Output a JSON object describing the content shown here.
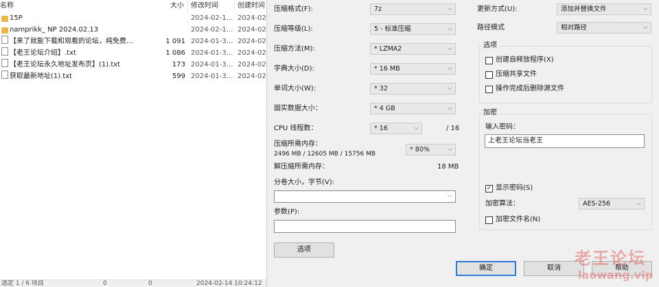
{
  "file_list": {
    "headers": {
      "name": "名称",
      "size": "大小",
      "modified": "修改时间",
      "created": "创建时间"
    },
    "rows": [
      {
        "icon": "folder-icon",
        "name": "15P",
        "size": "",
        "modified": "2024-02-1...",
        "created": "2024-02"
      },
      {
        "icon": "folder-icon",
        "name": "namprikk_ NP 2024.02.13",
        "size": "",
        "modified": "2024-02-1...",
        "created": "2024-02"
      },
      {
        "icon": "text-file-icon",
        "name": "【来了就能下载和观看的论坛，纯免费...",
        "size": "1 091",
        "modified": "2024-01-3...",
        "created": "2024-02"
      },
      {
        "icon": "text-file-icon",
        "name": "【老王论坛介绍】.txt",
        "size": "1 086",
        "modified": "2024-01-3...",
        "created": "2024-02"
      },
      {
        "icon": "text-file-icon",
        "name": "【老王论坛永久地址发布页】(1).txt",
        "size": "173",
        "modified": "2024-01-3...",
        "created": "2024-02"
      },
      {
        "icon": "text-file-icon",
        "name": "获取最新地址(1).txt",
        "size": "599",
        "modified": "2024-01-3...",
        "created": "2024-02"
      }
    ],
    "status": {
      "left": "选定 1 / 6 项目",
      "mid1": "0",
      "mid2": "0",
      "right": "2024-02-14 10:24:12"
    }
  },
  "dialog": {
    "format": {
      "label": "压缩格式(F):",
      "value": "7z"
    },
    "level": {
      "label": "压缩等级(L):",
      "value": "5 - 标准压缩"
    },
    "method": {
      "label": "压缩方法(M):",
      "value": "* LZMA2"
    },
    "dict": {
      "label": "字典大小(D):",
      "value": "* 16 MB"
    },
    "word": {
      "label": "单词大小(W):",
      "value": "* 32"
    },
    "solid": {
      "label": "固实数据大小：",
      "value": "* 4 GB"
    },
    "threads": {
      "label": "CPU 线程数：",
      "value": "* 16",
      "total": "/ 16"
    },
    "mem_compress": {
      "label": "压缩所需内存：",
      "detail": "2496 MB / 12605 MB / 15756 MB",
      "value": "* 80%"
    },
    "mem_decompress": {
      "label": "解压缩所需内存：",
      "value": "18 MB"
    },
    "split": {
      "label": "分卷大小，字节(V):",
      "value": ""
    },
    "params": {
      "label": "参数(P):",
      "value": ""
    },
    "options_button": "选项",
    "update": {
      "label": "更新方式(U):",
      "value": "添加并替换文件"
    },
    "path": {
      "label": "路径模式",
      "value": "相对路径"
    },
    "options_group": {
      "title": "选项",
      "sfx": "创建自释放程序(X)",
      "shared": "压缩共享文件",
      "delete": "操作完成后删除源文件"
    },
    "encryption": {
      "title": "加密",
      "password_label": "输入密码：",
      "password": "上老王论坛当老王",
      "show_password": "显示密码(S)",
      "method_label": "加密算法：",
      "method": "AES-256",
      "encrypt_names": "加密文件名(N)"
    },
    "ok": "确定",
    "cancel": "取消",
    "help": "帮助"
  },
  "watermark": {
    "line1": "老王论坛",
    "line2": "laowang.vip"
  }
}
